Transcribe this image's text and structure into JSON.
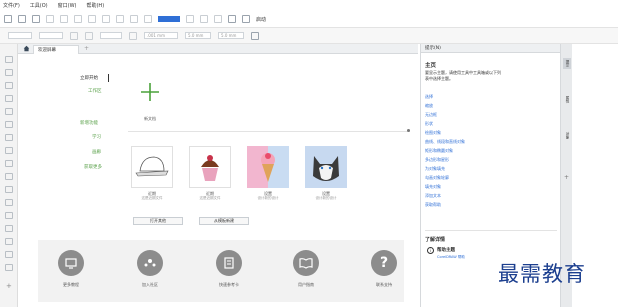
{
  "menu": [
    "文件(F)",
    "工具(O)",
    "窗口(W)",
    "帮助(H)"
  ],
  "toolbar": {
    "launch_label": "启动",
    "accent": "#2f6fd6"
  },
  "propbar": {
    "nudge": ".001 mm",
    "dup_x": "5.0 mm",
    "dup_y": "5.0 mm"
  },
  "doc_tab": "欢迎屏幕",
  "welcome_nav": {
    "active": "立即开始",
    "items": [
      "工作区",
      "新增功能",
      "学习",
      "画廊",
      "获取更多"
    ]
  },
  "new_doc": {
    "label": "新文档"
  },
  "recent": [
    {
      "title": "近期",
      "sub": "这是近期文件"
    },
    {
      "title": "近期",
      "sub": "这是近期文件"
    },
    {
      "title": "设置",
      "sub": "设计新的设计"
    },
    {
      "title": "设置",
      "sub": "设计新的设计"
    }
  ],
  "buttons": {
    "open_other": "打开其他",
    "from_template": "从模板新建"
  },
  "bottom_links": [
    {
      "label": "更多教程",
      "icon": "monitor-icon"
    },
    {
      "label": "加入社区",
      "icon": "community-icon"
    },
    {
      "label": "快速参考卡",
      "icon": "document-icon"
    },
    {
      "label": "用户指南",
      "icon": "book-icon"
    },
    {
      "label": "联系支持",
      "icon": "question-icon"
    }
  ],
  "hints": {
    "panel_title": "提示(N)",
    "heading": "主页",
    "intro": "要显示主题，请使用工具中工具箱或以下列表中选择主题。",
    "links": [
      "选择",
      "缩放",
      "无边框",
      "形状",
      "绘图对象",
      "曲线、线段和直线对象",
      "矩形和椭圆对象",
      "多边形和星形",
      "为对象填充",
      "勾画对象轮廓",
      "填充对象",
      "添加文本",
      "获取帮助"
    ],
    "learn_more": "了解详情",
    "help_topic": "帮助主题",
    "help_sub": "CorelDRAW 帮助"
  },
  "side_tabs": [
    "提示",
    "属性",
    "对象"
  ],
  "watermark": "最需教育"
}
